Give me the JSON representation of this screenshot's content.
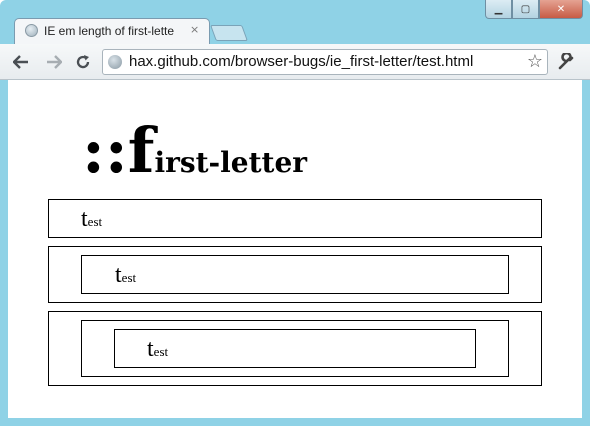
{
  "browser": {
    "tab_title": "IE em length of first-lette",
    "tab_close": "×",
    "url": "hax.github.com/browser-bugs/ie_first-letter/test.html",
    "controls": {
      "minimize": "▁",
      "maximize": "▢",
      "close": "✕"
    },
    "icons": {
      "back": "back-arrow-icon",
      "forward": "forward-arrow-icon",
      "reload": "reload-icon",
      "bookmark": "star-icon",
      "menu": "wrench-icon"
    }
  },
  "page": {
    "heading_first": "::f",
    "heading_rest": "irst-letter",
    "boxes": [
      {
        "first_letter": "t",
        "rest": "est"
      },
      {
        "first_letter": "t",
        "rest": "est"
      },
      {
        "first_letter": "t",
        "rest": "est"
      }
    ]
  },
  "colors": {
    "frame": "#8fd2e6",
    "tab_bg": "#f4f6f8",
    "close_button": "#c75b45"
  }
}
